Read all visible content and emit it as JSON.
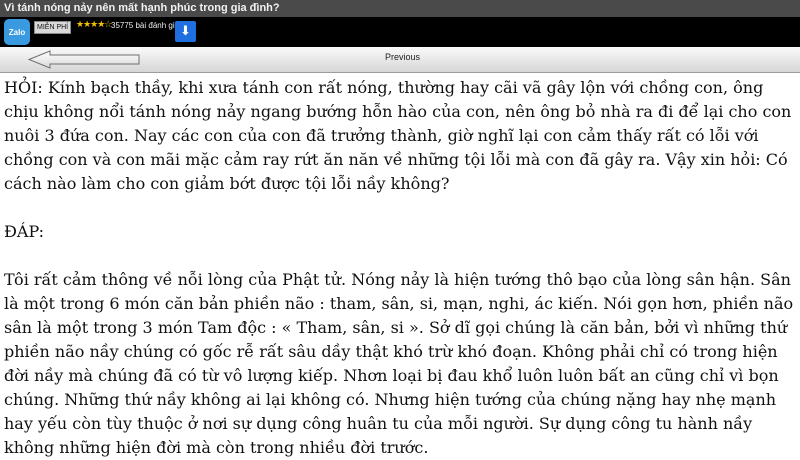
{
  "window": {
    "title": "Vì tánh nóng nảy nên mất hạnh phúc trong gia đình?"
  },
  "ad": {
    "app_icon_label": "Zalo",
    "free_badge": "MIỄN PHÍ",
    "stars": "★★★★☆",
    "rating_count": "35775 bài đánh giá",
    "download_icon": "download-arrow-icon"
  },
  "nav": {
    "previous_label": "Previous",
    "back_icon": "arrow-left-icon"
  },
  "article": {
    "question": "HỎI: Kính bạch thầy, khi xưa tánh con rất nóng, thường hay cãi vã gây lộn với chồng con, ông chịu không nổi tánh nóng nảy ngang bướng hỗn hào của con, nên ông bỏ nhà ra đi để lại cho con nuôi 3 đứa con. Nay các con của con đã trưởng thành, giờ nghĩ lại con cảm thấy rất có lỗi với chồng con và con mãi mặc cảm ray rứt ăn năn về những tội lỗi mà con đã gây ra. Vậy xin hỏi: Có cách nào làm cho con giảm bớt được tội lỗi nầy không?",
    "answer_heading": "ĐÁP:",
    "answer": "Tôi rất cảm thông về nỗi lòng của Phật tử. Nóng nảy là hiện tướng thô bạo của lòng sân hận. Sân là một trong 6 món căn bản phiền não : tham, sân, si, mạn, nghi, ác kiến. Nói gọn hơn, phiền não sân là một trong 3 món Tam độc : « Tham, sân, si ». Sở dĩ gọi chúng là căn bản, bởi vì những thứ phiền não nầy chúng có gốc rễ rất sâu dầy thật khó trừ khó đoạn. Không phải chỉ có trong hiện đời nầy mà chúng đã có từ vô lượng kiếp. Nhơn loại bị đau khổ luôn luôn bất an cũng chỉ vì bọn chúng. Những thứ nầy không ai lại không có. Nhưng hiện tướng của chúng nặng hay nhẹ mạnh hay yếu còn tùy thuộc ở nơi sự dụng công huân tu của mỗi người. Sự dụng công tu hành nầy không những hiện đời mà còn trong nhiều đời trước."
  }
}
